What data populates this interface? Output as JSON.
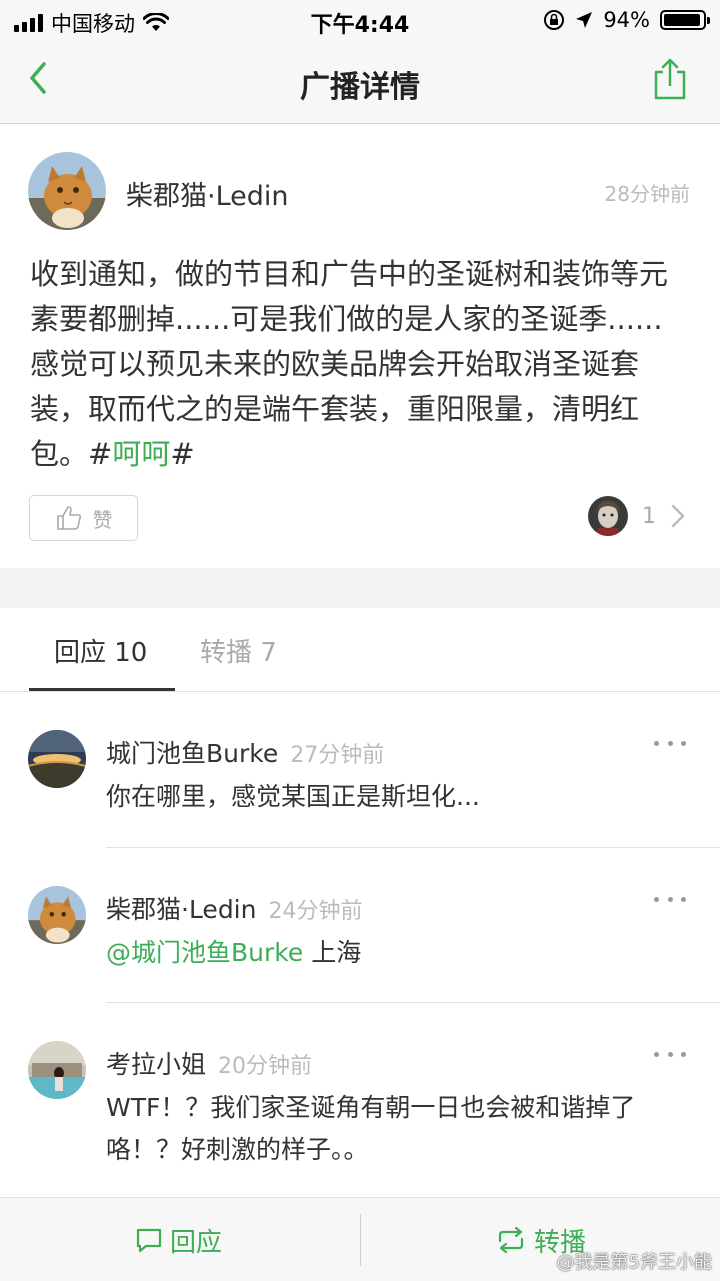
{
  "status_bar": {
    "carrier": "中国移动",
    "time": "下午4:44",
    "battery_percent": "94%",
    "battery_level": 0.94
  },
  "nav": {
    "title": "广播详情",
    "back_icon": "chevron-left-icon",
    "share_icon": "share-icon"
  },
  "post": {
    "author": "柴郡猫·Ledin",
    "time": "28分钟前",
    "body": "收到通知，做的节目和广告中的圣诞树和装饰等元素要都删掉......可是我们做的是人家的圣诞季......感觉可以预见未来的欧美品牌会开始取消圣诞套装，取而代之的是端午套装，重阳限量，清明红包。",
    "tag_open": "#",
    "tag": "呵呵",
    "tag_close": "#",
    "like_label": "赞",
    "like_count": "1"
  },
  "tabs": [
    {
      "label": "回应 10"
    },
    {
      "label": "转播 7"
    }
  ],
  "comments": [
    {
      "author": "城门池鱼Burke",
      "time": "27分钟前",
      "text": "你在哪里，感觉某国正是斯坦化..."
    },
    {
      "author": "柴郡猫·Ledin",
      "time": "24分钟前",
      "mention": "@城门池鱼Burke",
      "text": " 上海"
    },
    {
      "author": "考拉小姐",
      "time": "20分钟前",
      "text": "WTF！？我们家圣诞角有朝一日也会被和谐掉了咯！？好刺激的样子。。"
    }
  ],
  "bottom_bar": {
    "reply_label": "回应",
    "repost_label": "转播"
  },
  "watermark": "@我是第5斧王小能",
  "colors": {
    "accent": "#3cae55",
    "muted": "#bbbbbb",
    "text": "#333333"
  }
}
